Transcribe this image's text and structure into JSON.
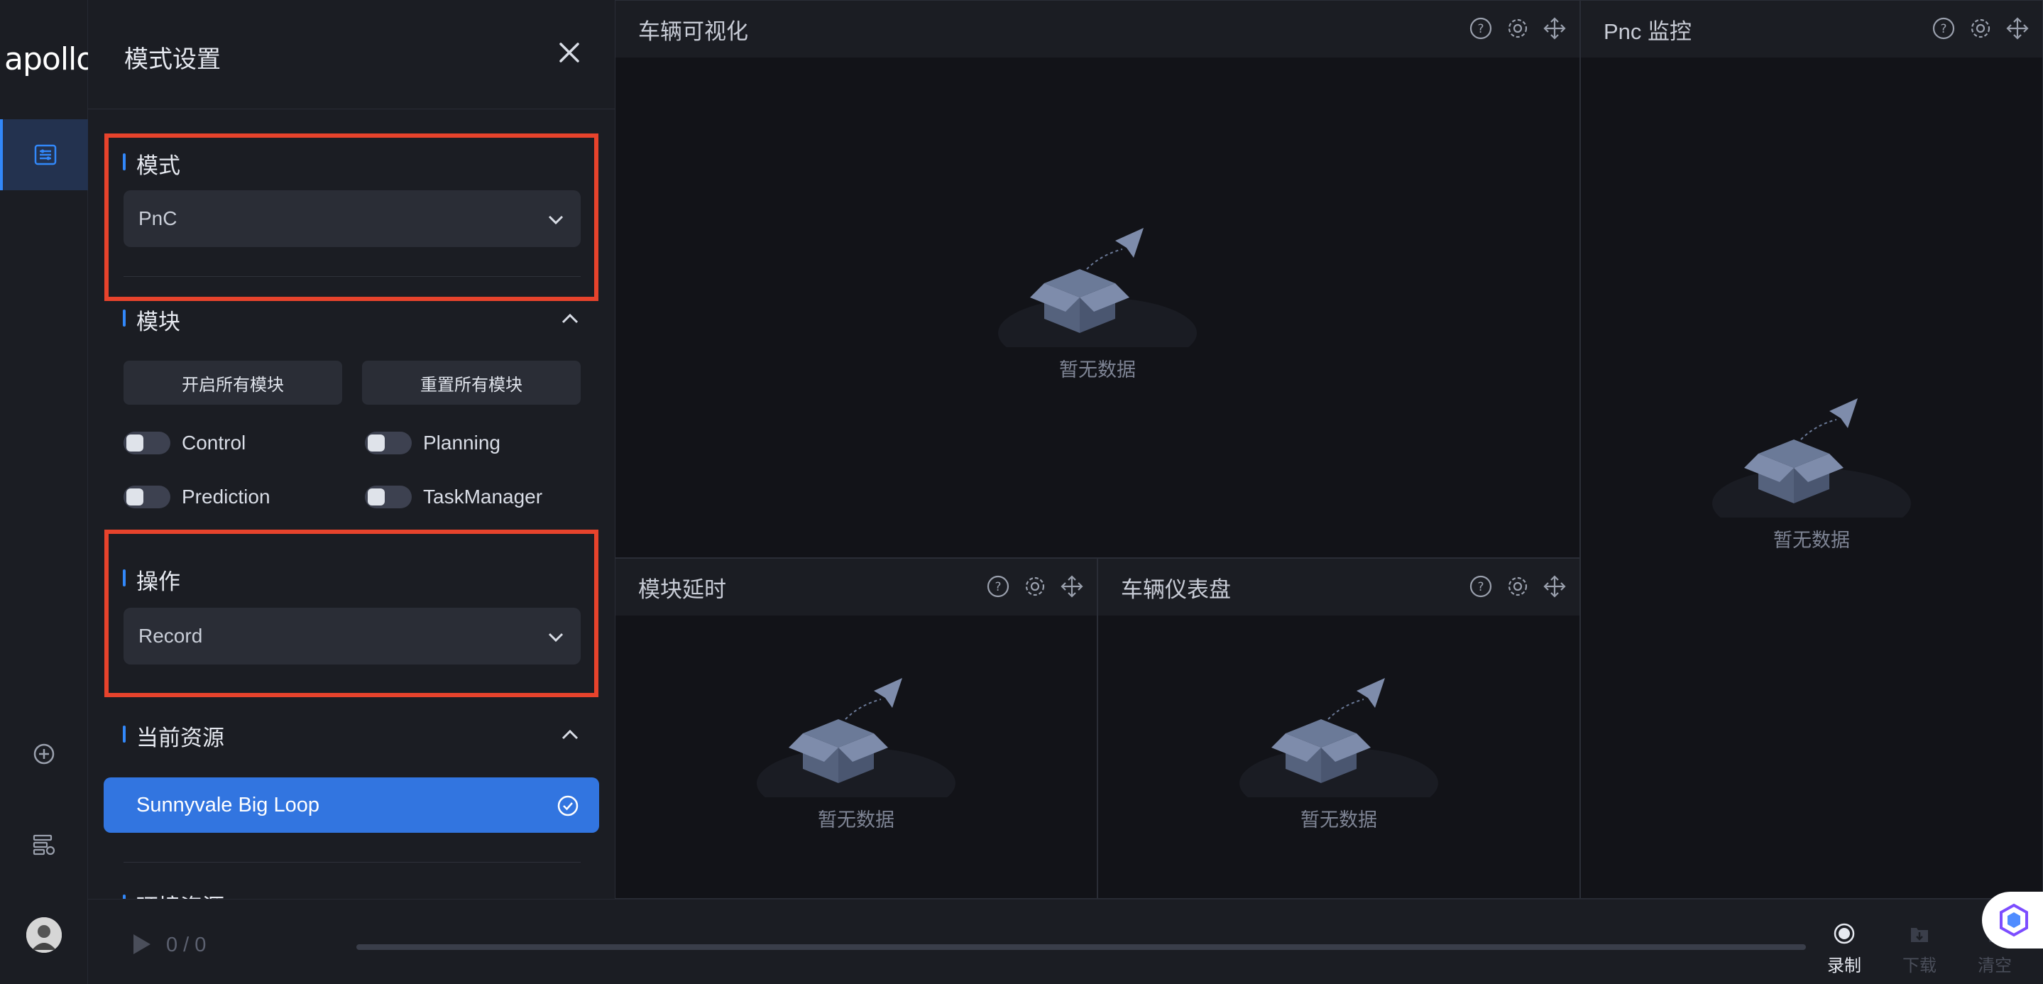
{
  "logo": "apollo",
  "panel": {
    "title": "模式设置",
    "mode_section": {
      "title": "模式",
      "selected": "PnC"
    },
    "module_section": {
      "title": "模块",
      "start_all": "开启所有模块",
      "reset_all": "重置所有模块",
      "modules": [
        {
          "label": "Control",
          "enabled": false
        },
        {
          "label": "Planning",
          "enabled": false
        },
        {
          "label": "Prediction",
          "enabled": false
        },
        {
          "label": "TaskManager",
          "enabled": false
        }
      ]
    },
    "operation_section": {
      "title": "操作",
      "selected": "Record"
    },
    "resource_section": {
      "title": "当前资源",
      "current": "Sunnyvale Big Loop"
    },
    "env_section": {
      "title": "环境资源"
    }
  },
  "widgets": {
    "vehicle_viz": {
      "title": "车辆可视化",
      "empty": "暂无数据"
    },
    "pnc_monitor": {
      "title": "Pnc 监控",
      "empty": "暂无数据"
    },
    "module_delay": {
      "title": "模块延时",
      "empty": "暂无数据"
    },
    "dashboard": {
      "title": "车辆仪表盘",
      "empty": "暂无数据"
    }
  },
  "player": {
    "progress": "0 / 0",
    "record_label": "录制",
    "download_label": "下载",
    "clear_label": "清空"
  },
  "colors": {
    "accent": "#3288fa",
    "highlight": "#e7432c",
    "panel_bg": "#1b1d23",
    "content_bg": "#121318"
  }
}
